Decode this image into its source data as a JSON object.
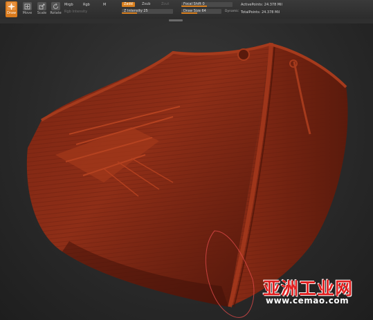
{
  "toolbar": {
    "tools": [
      {
        "label": "Draw",
        "icon": "draw-icon",
        "active": true
      },
      {
        "label": "Move",
        "icon": "move-icon",
        "active": false
      },
      {
        "label": "Scale",
        "icon": "scale-icon",
        "active": false
      },
      {
        "label": "Rotate",
        "icon": "rotate-icon",
        "active": false
      }
    ],
    "shading": {
      "mrgb": "Mrgb",
      "rgb": "Rgb",
      "m": "M",
      "rgb_intensity": "Rgb Intensity"
    },
    "modes": {
      "zadd": "Zadd",
      "zsub": "Zsub",
      "zcut": "Zcut"
    },
    "z_intensity": {
      "label": "Z Intensity 25",
      "value": 25
    },
    "focal_shift": {
      "label": "Focal Shift 0",
      "value": 0
    },
    "draw_size": {
      "label": "Draw Size 64",
      "value": 64
    },
    "dynamic": "Dynamic",
    "active_points": "ActivePoints: 24.378 Mil",
    "total_points": "TotalPoints: 24.378 Mil",
    "accent_color": "#d9801f"
  },
  "viewport": {
    "model": "ship-hull-sculpt",
    "model_color": "#8a2a14"
  },
  "watermark": {
    "chinese": "亚洲工业网",
    "url": "www.cemao.com"
  }
}
